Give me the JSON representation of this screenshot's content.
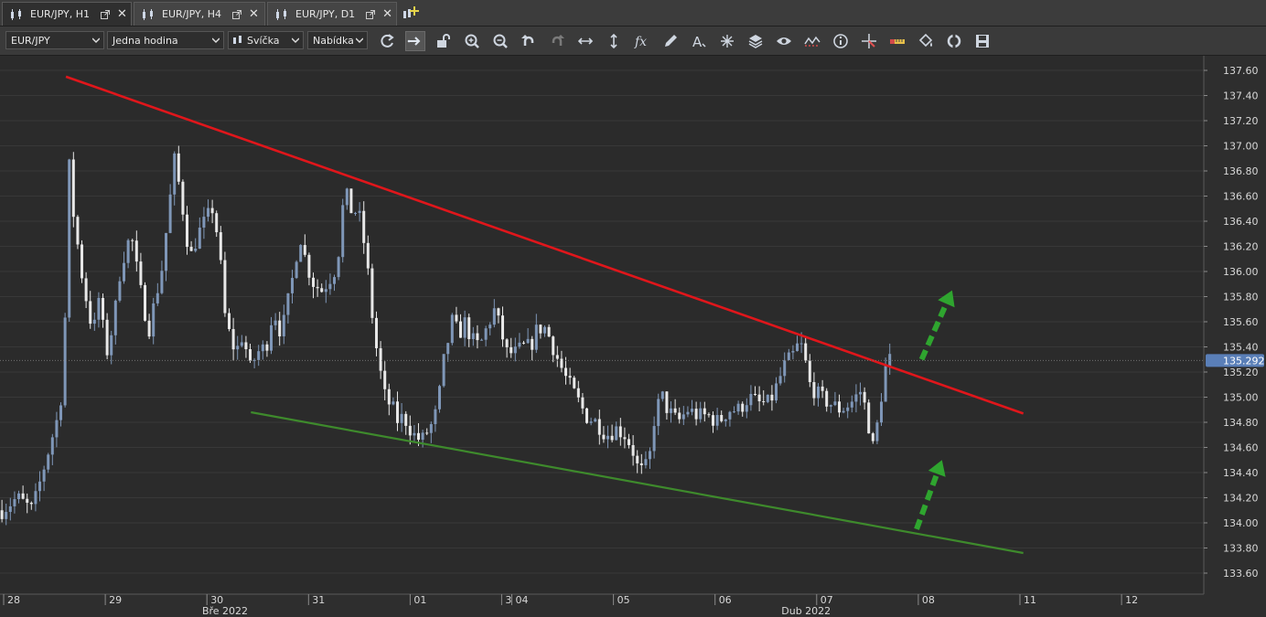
{
  "tabs": [
    {
      "label": "EUR/JPY, H1",
      "active": true
    },
    {
      "label": "EUR/JPY, H4",
      "active": false
    },
    {
      "label": "EUR/JPY, D1",
      "active": false
    }
  ],
  "toolbar": {
    "instrument": "EUR/JPY",
    "period": "Jedna hodina",
    "chart_type": "Svíčka",
    "price_side": "Nabídka",
    "tools": [
      "refresh-icon",
      "cursor-icon",
      "unlock-icon",
      "zoom-in-icon",
      "zoom-out-icon",
      "undo-icon",
      "redo-icon",
      "horizontal-arrows-icon",
      "vertical-arrows-icon",
      "function-icon",
      "pencil-icon",
      "text-icon",
      "crosshair-icon",
      "layers-icon",
      "eye-icon",
      "indicator-icon",
      "info-icon",
      "measure-icon",
      "ruler-icon",
      "paint-bucket-icon",
      "sync-icon",
      "save-icon"
    ]
  },
  "colors": {
    "background": "#2b2b2b",
    "candle_up": "#7f97b8",
    "candle_down": "#e8e8e8",
    "resistance": "#e0161b",
    "support": "#3e8a2c",
    "arrow": "#2fa52f",
    "price_tag": "#5a7fb8"
  },
  "chart_data": {
    "type": "candlestick",
    "instrument": "EUR/JPY",
    "timeframe": "H1",
    "current_price": "135.292",
    "y_ticks": [
      "137.60",
      "137.40",
      "137.20",
      "137.00",
      "136.80",
      "136.60",
      "136.40",
      "136.20",
      "136.00",
      "135.80",
      "135.60",
      "135.40",
      "135.20",
      "135.00",
      "134.80",
      "134.60",
      "134.40",
      "134.20",
      "134.00",
      "133.80",
      "133.60"
    ],
    "ylim": [
      133.43,
      137.7
    ],
    "x_labels": [
      {
        "label": "28",
        "day": 0
      },
      {
        "label": "29",
        "day": 1
      },
      {
        "label": "30",
        "day": 2
      },
      {
        "label": "31",
        "day": 3
      },
      {
        "label": "01",
        "day": 4
      },
      {
        "label": "3",
        "day": 4.9
      },
      {
        "label": "04",
        "day": 5
      },
      {
        "label": "05",
        "day": 6
      },
      {
        "label": "06",
        "day": 7
      },
      {
        "label": "07",
        "day": 8
      },
      {
        "label": "08",
        "day": 9
      },
      {
        "label": "11",
        "day": 10
      },
      {
        "label": "12",
        "day": 11
      }
    ],
    "month_labels": [
      {
        "label": "Bře 2022",
        "day": 1.8
      },
      {
        "label": "Dub 2022",
        "day": 7.5
      }
    ],
    "trendlines": [
      {
        "name": "resistance",
        "from": {
          "day": 0.28,
          "price": 137.55
        },
        "to": {
          "day": 9.7,
          "price": 134.87
        }
      },
      {
        "name": "support",
        "from": {
          "day": 2.1,
          "price": 134.88
        },
        "to": {
          "day": 9.7,
          "price": 133.76
        }
      }
    ],
    "arrows": [
      {
        "name": "upper-arrow",
        "from": {
          "day": 8.7,
          "price": 135.3
        },
        "to": {
          "day": 9.0,
          "price": 135.85
        }
      },
      {
        "name": "lower-arrow",
        "from": {
          "day": 8.65,
          "price": 133.95
        },
        "to": {
          "day": 8.9,
          "price": 134.5
        }
      }
    ],
    "path": [
      [
        -0.35,
        134.1
      ],
      [
        -0.2,
        134.2
      ],
      [
        -0.05,
        134.1
      ],
      [
        0.05,
        134.4
      ],
      [
        0.15,
        134.7
      ],
      [
        0.22,
        134.9
      ],
      [
        0.26,
        135.3
      ],
      [
        0.28,
        135.9
      ],
      [
        0.29,
        136.6
      ],
      [
        0.3,
        137.0
      ],
      [
        0.33,
        136.6
      ],
      [
        0.38,
        136.3
      ],
      [
        0.45,
        135.9
      ],
      [
        0.55,
        135.5
      ],
      [
        0.6,
        135.8
      ],
      [
        0.68,
        135.35
      ],
      [
        0.75,
        135.6
      ],
      [
        0.82,
        136.05
      ],
      [
        0.92,
        136.3
      ],
      [
        1.0,
        135.9
      ],
      [
        1.05,
        135.7
      ],
      [
        1.1,
        135.55
      ],
      [
        1.15,
        135.75
      ],
      [
        1.22,
        136.0
      ],
      [
        1.3,
        136.55
      ],
      [
        1.35,
        136.9
      ],
      [
        1.42,
        136.55
      ],
      [
        1.5,
        136.1
      ],
      [
        1.58,
        136.3
      ],
      [
        1.65,
        136.4
      ],
      [
        1.72,
        136.5
      ],
      [
        1.78,
        136.25
      ],
      [
        1.85,
        135.6
      ],
      [
        1.95,
        135.35
      ],
      [
        2.02,
        135.5
      ],
      [
        2.1,
        135.2
      ],
      [
        2.15,
        135.35
      ],
      [
        2.25,
        135.4
      ],
      [
        2.32,
        135.7
      ],
      [
        2.4,
        135.5
      ],
      [
        2.5,
        135.9
      ],
      [
        2.58,
        136.3
      ],
      [
        2.65,
        136.05
      ],
      [
        2.72,
        135.9
      ],
      [
        2.8,
        135.85
      ],
      [
        2.88,
        135.95
      ],
      [
        2.95,
        136.05
      ],
      [
        3.0,
        136.5
      ],
      [
        3.05,
        136.6
      ],
      [
        3.1,
        136.45
      ],
      [
        3.15,
        136.5
      ],
      [
        3.2,
        136.3
      ],
      [
        3.25,
        136.0
      ],
      [
        3.3,
        135.6
      ],
      [
        3.35,
        135.3
      ],
      [
        3.42,
        135.0
      ],
      [
        3.5,
        134.9
      ],
      [
        3.55,
        134.8
      ],
      [
        3.6,
        134.85
      ],
      [
        3.7,
        134.7
      ],
      [
        3.78,
        134.65
      ],
      [
        3.85,
        134.75
      ],
      [
        3.9,
        134.8
      ],
      [
        3.95,
        135.0
      ],
      [
        4.0,
        135.3
      ],
      [
        4.08,
        135.6
      ],
      [
        4.15,
        135.5
      ],
      [
        4.2,
        135.6
      ],
      [
        4.28,
        135.45
      ],
      [
        4.35,
        135.4
      ],
      [
        4.42,
        135.55
      ],
      [
        4.5,
        135.7
      ],
      [
        4.55,
        135.55
      ],
      [
        4.62,
        135.35
      ],
      [
        4.7,
        135.35
      ],
      [
        4.78,
        135.4
      ],
      [
        4.85,
        135.4
      ],
      [
        4.92,
        135.55
      ],
      [
        5.0,
        135.55
      ],
      [
        5.05,
        135.45
      ],
      [
        5.12,
        135.3
      ],
      [
        5.2,
        135.15
      ],
      [
        5.3,
        135.0
      ],
      [
        5.4,
        134.85
      ],
      [
        5.5,
        134.8
      ],
      [
        5.6,
        134.7
      ],
      [
        5.7,
        134.75
      ],
      [
        5.78,
        134.7
      ],
      [
        5.85,
        134.6
      ],
      [
        5.9,
        134.45
      ],
      [
        5.96,
        134.4
      ],
      [
        6.02,
        134.5
      ],
      [
        6.08,
        134.9
      ],
      [
        6.15,
        135.0
      ],
      [
        6.2,
        134.9
      ],
      [
        6.3,
        134.8
      ],
      [
        6.4,
        134.9
      ],
      [
        6.5,
        134.85
      ],
      [
        6.6,
        134.85
      ],
      [
        6.7,
        134.8
      ],
      [
        6.8,
        134.9
      ],
      [
        6.9,
        134.9
      ],
      [
        7.0,
        135.0
      ],
      [
        7.1,
        134.95
      ],
      [
        7.2,
        134.95
      ],
      [
        7.28,
        135.1
      ],
      [
        7.35,
        135.25
      ],
      [
        7.45,
        135.35
      ],
      [
        7.5,
        135.45
      ],
      [
        7.55,
        135.3
      ],
      [
        7.6,
        135.1
      ],
      [
        7.7,
        135.0
      ],
      [
        7.8,
        134.95
      ],
      [
        7.9,
        134.9
      ],
      [
        8.0,
        134.95
      ],
      [
        8.1,
        135.05
      ],
      [
        8.15,
        134.9
      ],
      [
        8.22,
        134.6
      ],
      [
        8.28,
        134.85
      ],
      [
        8.33,
        135.2
      ],
      [
        8.38,
        135.3
      ],
      [
        8.42,
        135.29
      ]
    ]
  }
}
